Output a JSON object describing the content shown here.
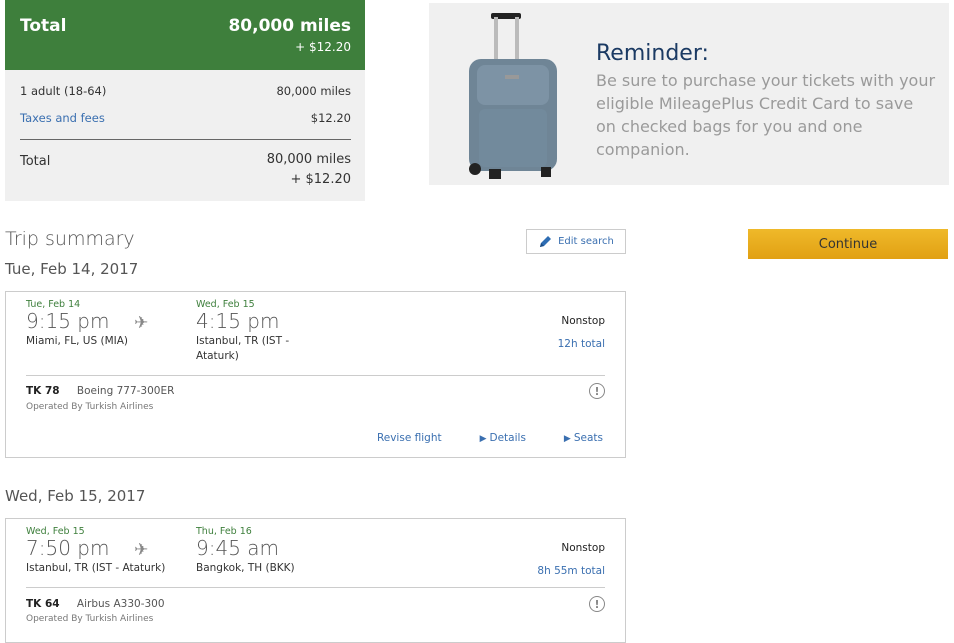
{
  "price": {
    "header_label": "Total",
    "header_miles": "80,000 miles",
    "header_cash": "+ $12.20",
    "rows": [
      {
        "label": "1 adult (18-64)",
        "value": "80,000 miles"
      },
      {
        "label": "Taxes and fees",
        "value": "$12.20"
      }
    ],
    "total_label": "Total",
    "total_miles": "80,000 miles",
    "total_cash": "+ $12.20"
  },
  "reminder": {
    "title": "Reminder:",
    "body": "Be sure to purchase your tickets with your eligible MileagePlus Credit Card to save on checked bags for you and one companion."
  },
  "trip": {
    "title": "Trip summary",
    "edit_label": "Edit search",
    "continue_label": "Continue"
  },
  "days": [
    {
      "date": "Tue, Feb 14, 2017",
      "flight": {
        "dep_date": "Tue, Feb 14",
        "dep_time": "9:15 pm",
        "dep_city": "Miami, FL, US (MIA)",
        "arr_date": "Wed, Feb 15",
        "arr_time": "4:15 pm",
        "arr_city": "Istanbul, TR (IST - Ataturk)",
        "stops": "Nonstop",
        "duration": "12h total",
        "number": "TK 78",
        "aircraft": "Boeing 777-300ER",
        "operated": "Operated By Turkish Airlines",
        "revise": "Revise flight",
        "details": "Details",
        "seats": "Seats"
      }
    },
    {
      "date": "Wed, Feb 15, 2017",
      "flight": {
        "dep_date": "Wed, Feb 15",
        "dep_time": "7:50 pm",
        "dep_city": "Istanbul, TR (IST - Ataturk)",
        "arr_date": "Thu, Feb 16",
        "arr_time": "9:45 am",
        "arr_city": "Bangkok, TH (BKK)",
        "stops": "Nonstop",
        "duration": "8h 55m total",
        "number": "TK 64",
        "aircraft": "Airbus A330-300",
        "operated": "Operated By Turkish Airlines"
      }
    }
  ]
}
